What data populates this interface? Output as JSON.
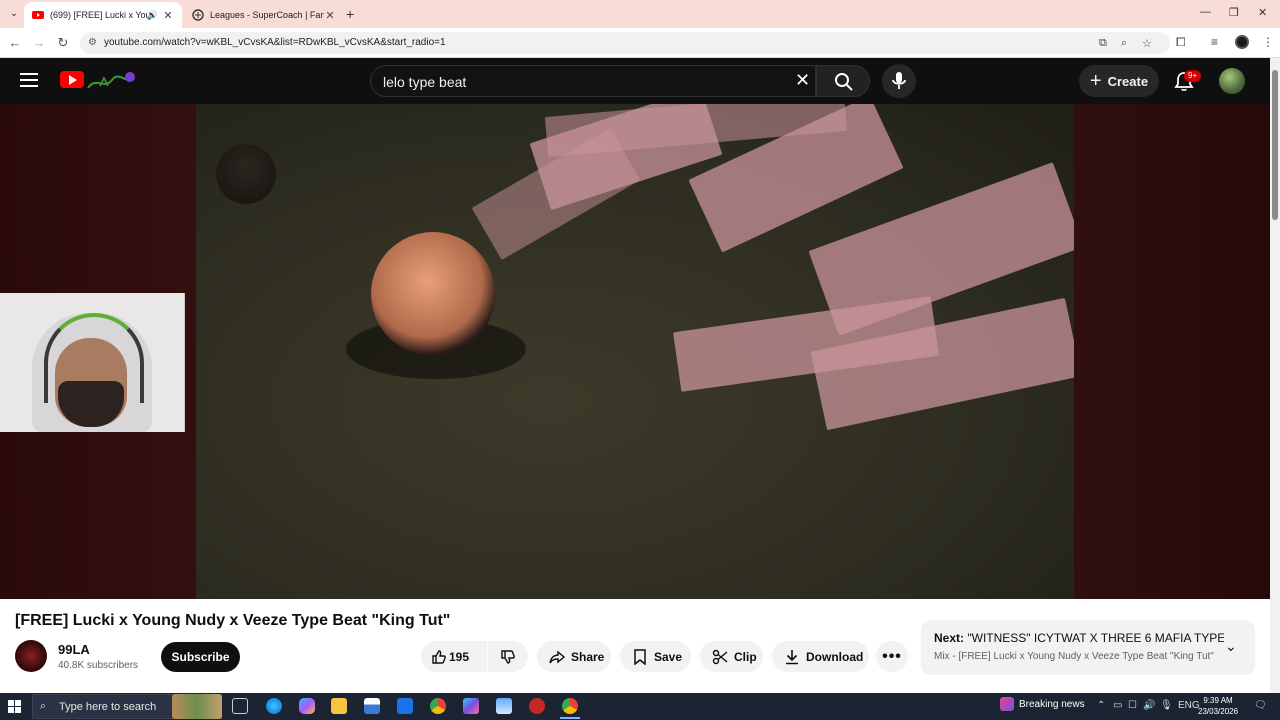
{
  "browser": {
    "tabs": [
      {
        "title": "(699) [FREE] Lucki x Young N",
        "active": true
      },
      {
        "title": "Leagues - SuperCoach | Fantas",
        "active": false
      }
    ],
    "new_tab": "+",
    "url": "youtube.com/watch?v=wKBL_vCvsKA&list=RDwKBL_vCvsKA&start_radio=1"
  },
  "youtube": {
    "search_value": "lelo type beat",
    "create_label": "Create",
    "notification_badge": "9+"
  },
  "video": {
    "title": "[FREE] Lucki x Young Nudy x Veeze Type Beat \"King Tut\"",
    "channel_name": "99LA",
    "subscribers": "40.8K subscribers",
    "subscribe_label": "Subscribe",
    "like_count": "195",
    "share_label": "Share",
    "save_label": "Save",
    "clip_label": "Clip",
    "download_label": "Download"
  },
  "next_card": {
    "prefix": "Next:",
    "title": "\"WITNESS\" ICYTWAT X THREE 6 MAFIA TYPE...",
    "subtitle": "Mix - [FREE] Lucki x Young Nudy x Veeze Type Beat \"King Tut\""
  },
  "taskbar": {
    "search_placeholder": "Type here to search",
    "news_label": "Breaking news",
    "language": "ENG",
    "time": "9:39 AM",
    "date": "23/03/2026"
  },
  "colors": {
    "youtube_red": "#ff0000",
    "dark_bg": "#0f0f0f",
    "tab_strip": "#f8dcd6",
    "taskbar": "#1c2333"
  }
}
